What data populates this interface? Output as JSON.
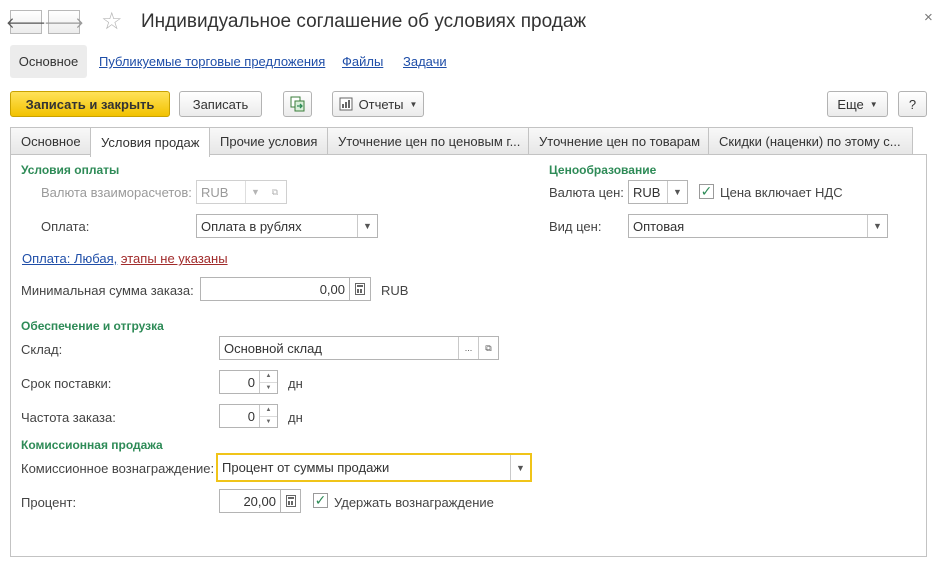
{
  "window": {
    "title": "Индивидуальное соглашение об условиях продаж",
    "back_glyph": "🡐",
    "forward_glyph": "🡒",
    "star_glyph": "☆",
    "close_glyph": "×"
  },
  "sections": {
    "active": "Основное",
    "links": [
      "Публикуемые торговые предложения",
      "Файлы",
      "Задачи"
    ]
  },
  "toolbar": {
    "save_close": "Записать и закрыть",
    "save": "Записать",
    "reports": "Отчеты",
    "more": "Еще",
    "help": "?"
  },
  "tabs": [
    "Основное",
    "Условия продаж",
    "Прочие условия",
    "Уточнение цен по ценовым г...",
    "Уточнение цен по товарам",
    "Скидки (наценки) по этому с..."
  ],
  "payment": {
    "group_title": "Условия оплаты",
    "currency_label": "Валюта взаиморасчетов:",
    "currency_value": "RUB",
    "payment_label": "Оплата:",
    "payment_value": "Оплата в рублях",
    "link_prefix": "Оплата: Любая,",
    "link_stages": "этапы не указаны",
    "min_amount_label": "Минимальная сумма заказа:",
    "min_amount_value": "0,00",
    "min_amount_unit": "RUB"
  },
  "pricing": {
    "group_title": "Ценообразование",
    "currency_label": "Валюта цен:",
    "currency_value": "RUB",
    "vat_label": "Цена включает НДС",
    "price_type_label": "Вид цен:",
    "price_type_value": "Оптовая"
  },
  "shipping": {
    "group_title": "Обеспечение и отгрузка",
    "warehouse_label": "Склад:",
    "warehouse_value": "Основной склад",
    "lead_time_label": "Срок поставки:",
    "lead_time_value": "0",
    "lead_time_unit": "дн",
    "frequency_label": "Частота заказа:",
    "frequency_value": "0",
    "frequency_unit": "дн"
  },
  "commission": {
    "group_title": "Комиссионная продажа",
    "reward_label": "Комиссионное вознаграждение:",
    "reward_value": "Процент от суммы продажи",
    "percent_label": "Процент:",
    "percent_value": "20,00",
    "withhold_label": "Удержать вознаграждение"
  },
  "glyphs": {
    "dropdown": "▼",
    "ellipsis": "...",
    "open": "⧉",
    "checkmark": "✓",
    "up": "▲",
    "down": "▼"
  }
}
